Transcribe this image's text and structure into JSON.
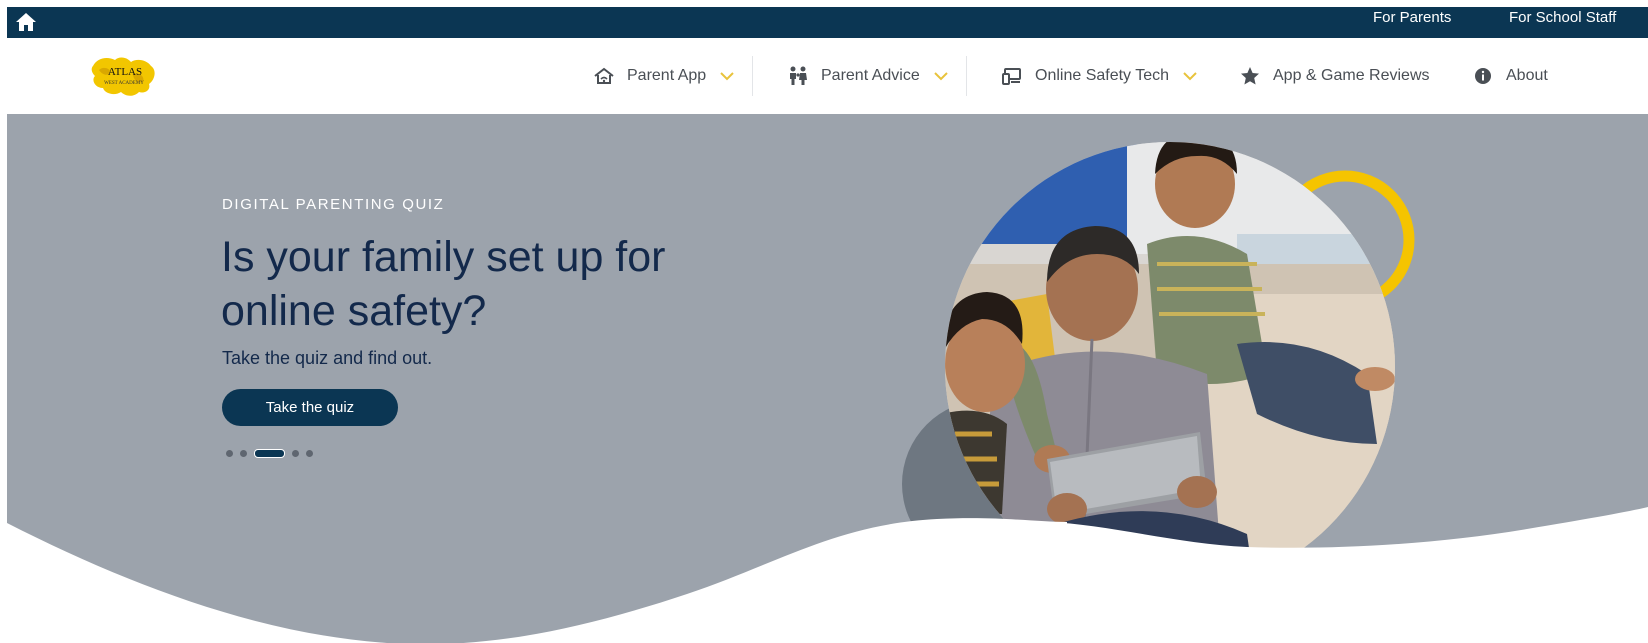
{
  "topbar": {
    "home_icon": "home-icon",
    "links": [
      "For Parents",
      "For School Staff"
    ]
  },
  "nav": {
    "logo_text": "ATLAS",
    "logo_subtext": "WEST ACADEMY",
    "items": [
      {
        "label": "Parent App",
        "icon": "house-with-signal-icon",
        "has_dropdown": true
      },
      {
        "label": "Parent Advice",
        "icon": "family-icon",
        "has_dropdown": true
      },
      {
        "label": "Online Safety Tech",
        "icon": "devices-icon",
        "has_dropdown": true
      },
      {
        "label": "App & Game Reviews",
        "icon": "star-icon",
        "has_dropdown": false
      },
      {
        "label": "About",
        "icon": "info-icon",
        "has_dropdown": false
      }
    ]
  },
  "hero": {
    "eyebrow": "DIGITAL PARENTING QUIZ",
    "headline": "Is your family set up for online safety?",
    "subline": "Take the quiz and find out.",
    "cta": "Take the quiz",
    "carousel": {
      "slides": 5,
      "active": 3
    }
  },
  "colors": {
    "navy": "#0b3653",
    "hero_bg": "#9ca3ac",
    "headline": "#13294b",
    "accent_yellow": "#f5c400",
    "chevron": "#e8c33c"
  }
}
